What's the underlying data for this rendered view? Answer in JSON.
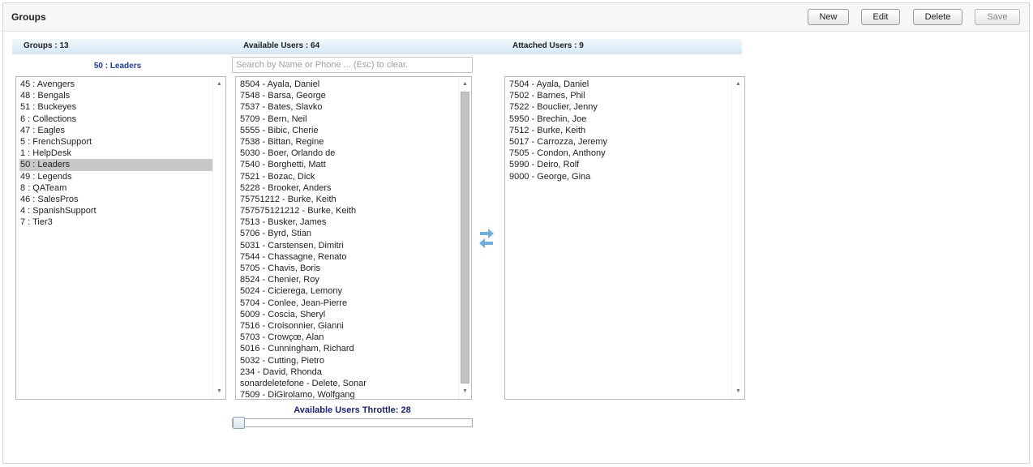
{
  "page": {
    "title": "Groups"
  },
  "toolbar": {
    "new_label": "New",
    "edit_label": "Edit",
    "delete_label": "Delete",
    "save_label": "Save"
  },
  "headers": {
    "groups_label": "Groups",
    "groups_count": "13",
    "available_label": "Available Users",
    "available_count": "64",
    "attached_label": "Attached Users",
    "attached_count": "9"
  },
  "selected_group": "50 : Leaders",
  "search": {
    "value": "",
    "placeholder": "Search by Name or Phone ... (Esc) to clear."
  },
  "groups": [
    {
      "label": "45 : Avengers",
      "selected": false
    },
    {
      "label": "48 : Bengals",
      "selected": false
    },
    {
      "label": "51 : Buckeyes",
      "selected": false
    },
    {
      "label": "6 : Collections",
      "selected": false
    },
    {
      "label": "47 : Eagles",
      "selected": false
    },
    {
      "label": "5 : FrenchSupport",
      "selected": false
    },
    {
      "label": "1 : HelpDesk",
      "selected": false
    },
    {
      "label": "50 : Leaders",
      "selected": true
    },
    {
      "label": "49 : Legends",
      "selected": false
    },
    {
      "label": "8 : QATeam",
      "selected": false
    },
    {
      "label": "46 : SalesPros",
      "selected": false
    },
    {
      "label": "4 : SpanishSupport",
      "selected": false
    },
    {
      "label": "7 : Tier3",
      "selected": false
    }
  ],
  "available_users": [
    "8504 - Ayala, Daniel",
    "7548 - Barsa, George",
    "7537 - Bates, Slavko",
    "5709 - Bern, Neil",
    "5555 - Bibic, Cherie",
    "7538 - Bittan, Regine",
    "5030 - Boer, Orlando de",
    "7540 - Borghetti, Matt",
    "7521 - Bozac, Dick",
    "5228 - Brooker, Anders",
    "75751212 - Burke, Keith",
    "757575121212 - Burke, Keith",
    "7513 - Busker, James",
    "5706 - Byrd, Stian",
    "5031 - Carstensen, Dimitri",
    "7544 - Chassagne, Renato",
    "5705 - Chavis, Boris",
    "8524 - Chenier, Roy",
    "5024 - Cicierega, Lemony",
    "5704 - Conlee, Jean-Pierre",
    "5009 - Coscia, Sheryl",
    "7516 - Croisonnier, Gianni",
    "5703 - Crowçœ, Alan",
    "5016 - Cunningham, Richard",
    "5032 - Cutting, Pietro",
    "234 - David, Rhonda",
    "sonardeletefone - Delete, Sonar",
    "7509 - DiGirolamo, Wolfgang"
  ],
  "attached_users": [
    "7504 - Ayala, Daniel",
    "7502 - Barnes, Phil",
    "7522 - Bouclier, Jenny",
    "5950 - Brechin, Joe",
    "7512 - Burke, Keith",
    "5017 - Carrozza, Jeremy",
    "7505 - Condon, Anthony",
    "5990 - Deiro, Rolf",
    "9000 - George, Gina"
  ],
  "throttle": {
    "label": "Available Users Throttle: 28",
    "value": 28
  },
  "icons": {
    "transfer": "transfer-arrows-icon",
    "scroll_up": "scroll-up-icon",
    "scroll_down": "scroll-down-icon"
  },
  "colors": {
    "header_strip_top": "#f2f8fc",
    "header_strip_bottom": "#d3e7f4",
    "selected_group_text": "#1a3a9e",
    "throttle_text": "#1a237e",
    "transfer_arrows": "#6aaee0",
    "selected_row": "#c8c8c8"
  }
}
